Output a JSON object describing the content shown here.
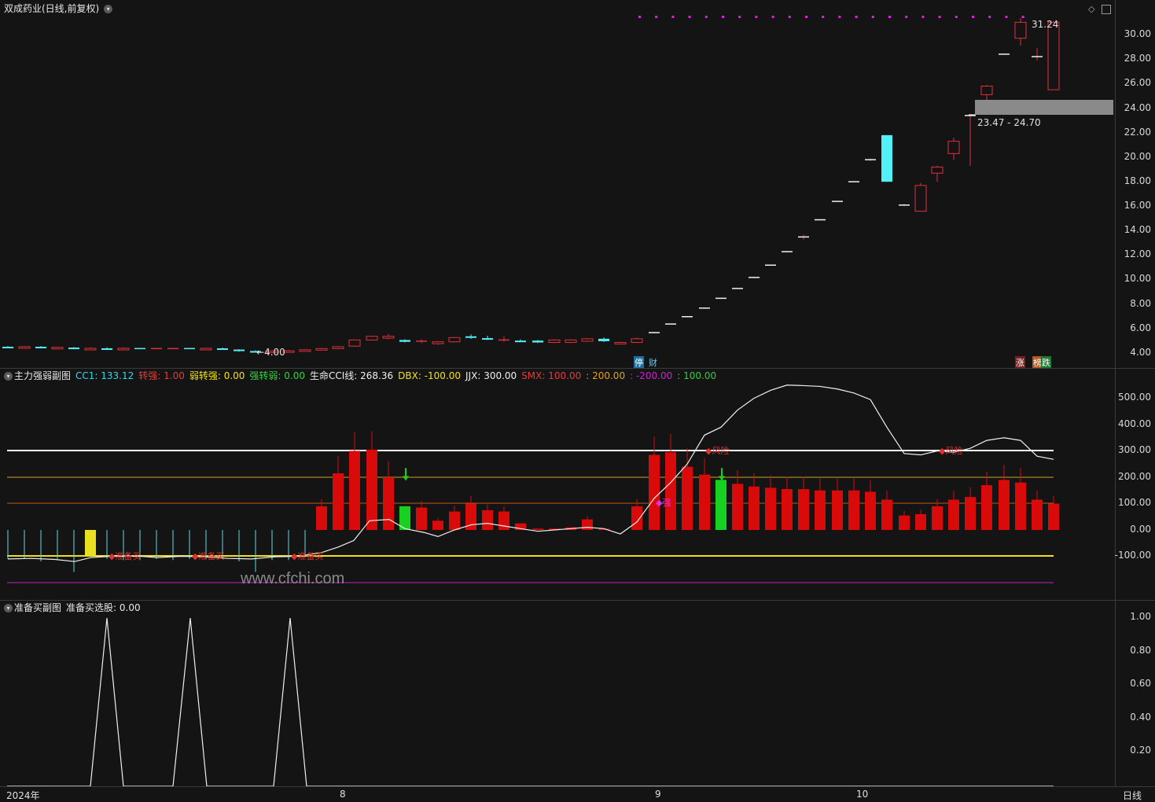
{
  "main": {
    "title": "双成药业(日线,前复权)",
    "high_label": "31.24",
    "low_label": "4.00",
    "range_label": "23.47 - 24.70",
    "events": [
      "停",
      "财"
    ],
    "tags": [
      "涨",
      "榜",
      "跌"
    ],
    "y_ticks": [
      "30.00",
      "28.00",
      "26.00",
      "24.00",
      "22.00",
      "20.00",
      "18.00",
      "16.00",
      "14.00",
      "12.00",
      "10.00",
      "8.00",
      "6.00",
      "4.00"
    ]
  },
  "cci": {
    "title": "主力强弱副图",
    "cc1": "CC1: 133.12",
    "zq": "转强: 1.00",
    "rzq": "弱转强: 0.00",
    "qzr": "强转弱: 0.00",
    "life": "生命CCI线: 268.36",
    "dbx": "DBX: -100.00",
    "jjx": "JJX: 300.00",
    "smx": "SMX: 100.00",
    "v200": ": 200.00",
    "vm200": ": -200.00",
    "v100": ": 100.00",
    "y_ticks": [
      "500.00",
      "400.00",
      "300.00",
      "200.00",
      "100.00",
      "0.00",
      "-100.00"
    ],
    "labels": [
      "准备买",
      "准备买",
      "准备买",
      "强",
      "风险",
      "风险"
    ]
  },
  "prep": {
    "title": "准备买副图",
    "value": "准备买选股: 0.00",
    "y_ticks": [
      "1.00",
      "0.80",
      "0.60",
      "0.40",
      "0.20"
    ]
  },
  "xaxis": {
    "labels": [
      "2024年",
      "8",
      "9",
      "10"
    ],
    "period": "日线"
  },
  "watermark": "www.cfchi.com",
  "colors": {
    "up": "#e0303a",
    "down": "#54f0f8",
    "bg": "#141414",
    "magenta": "#e020e0"
  }
}
